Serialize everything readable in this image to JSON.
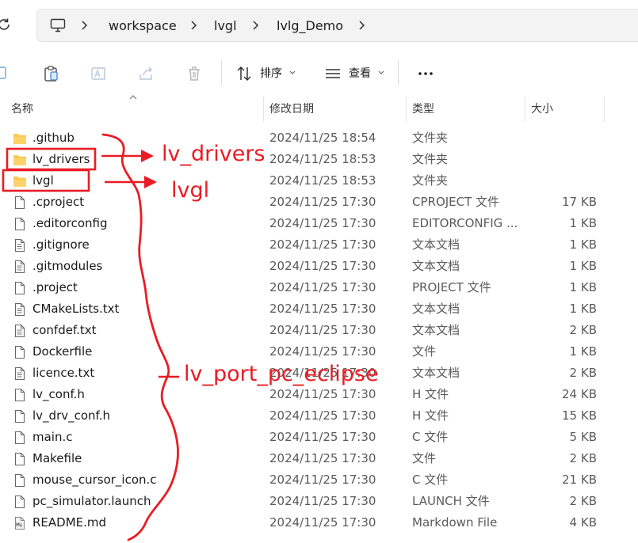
{
  "breadcrumb": {
    "items": [
      "workspace",
      "lvgl",
      "lvlg_Demo"
    ]
  },
  "toolbar": {
    "sort_label": "排序",
    "view_label": "查看"
  },
  "columns": {
    "name": "名称",
    "date": "修改日期",
    "type": "类型",
    "size": "大小"
  },
  "files": [
    {
      "name": ".github",
      "date": "2024/11/25 18:54",
      "type": "文件夹",
      "size": "",
      "icon": "folder-icon"
    },
    {
      "name": "lv_drivers",
      "date": "2024/11/25 18:53",
      "type": "文件夹",
      "size": "",
      "icon": "folder-icon"
    },
    {
      "name": "lvgl",
      "date": "2024/11/25 18:53",
      "type": "文件夹",
      "size": "",
      "icon": "folder-icon"
    },
    {
      "name": ".cproject",
      "date": "2024/11/25 17:30",
      "type": "CPROJECT 文件",
      "size": "17 KB",
      "icon": "file-icon"
    },
    {
      "name": ".editorconfig",
      "date": "2024/11/25 17:30",
      "type": "EDITORCONFIG ...",
      "size": "1 KB",
      "icon": "file-icon"
    },
    {
      "name": ".gitignore",
      "date": "2024/11/25 17:30",
      "type": "文本文档",
      "size": "1 KB",
      "icon": "text-file-icon"
    },
    {
      "name": ".gitmodules",
      "date": "2024/11/25 17:30",
      "type": "文本文档",
      "size": "1 KB",
      "icon": "text-file-icon"
    },
    {
      "name": ".project",
      "date": "2024/11/25 17:30",
      "type": "PROJECT 文件",
      "size": "1 KB",
      "icon": "file-icon"
    },
    {
      "name": "CMakeLists.txt",
      "date": "2024/11/25 17:30",
      "type": "文本文档",
      "size": "1 KB",
      "icon": "text-file-icon"
    },
    {
      "name": "confdef.txt",
      "date": "2024/11/25 17:30",
      "type": "文本文档",
      "size": "2 KB",
      "icon": "text-file-icon"
    },
    {
      "name": "Dockerfile",
      "date": "2024/11/25 17:30",
      "type": "文件",
      "size": "1 KB",
      "icon": "file-icon"
    },
    {
      "name": "licence.txt",
      "date": "2024/11/25 17:30",
      "type": "文本文档",
      "size": "2 KB",
      "icon": "text-file-icon"
    },
    {
      "name": "lv_conf.h",
      "date": "2024/11/25 17:30",
      "type": "H 文件",
      "size": "24 KB",
      "icon": "file-icon"
    },
    {
      "name": "lv_drv_conf.h",
      "date": "2024/11/25 17:30",
      "type": "H 文件",
      "size": "15 KB",
      "icon": "file-icon"
    },
    {
      "name": "main.c",
      "date": "2024/11/25 17:30",
      "type": "C 文件",
      "size": "5 KB",
      "icon": "file-icon"
    },
    {
      "name": "Makefile",
      "date": "2024/11/25 17:30",
      "type": "文件",
      "size": "2 KB",
      "icon": "file-icon"
    },
    {
      "name": "mouse_cursor_icon.c",
      "date": "2024/11/25 17:30",
      "type": "C 文件",
      "size": "21 KB",
      "icon": "file-icon"
    },
    {
      "name": "pc_simulator.launch",
      "date": "2024/11/25 17:30",
      "type": "LAUNCH 文件",
      "size": "2 KB",
      "icon": "file-icon"
    },
    {
      "name": "README.md",
      "date": "2024/11/25 17:30",
      "type": "Markdown File",
      "size": "4 KB",
      "icon": "markdown-file-icon"
    }
  ],
  "annotations": {
    "label_drivers": "lv_drivers",
    "label_lvgl": "lvgl",
    "label_project": "lv_port_pc_eclipse",
    "color": "#ea1c24"
  }
}
